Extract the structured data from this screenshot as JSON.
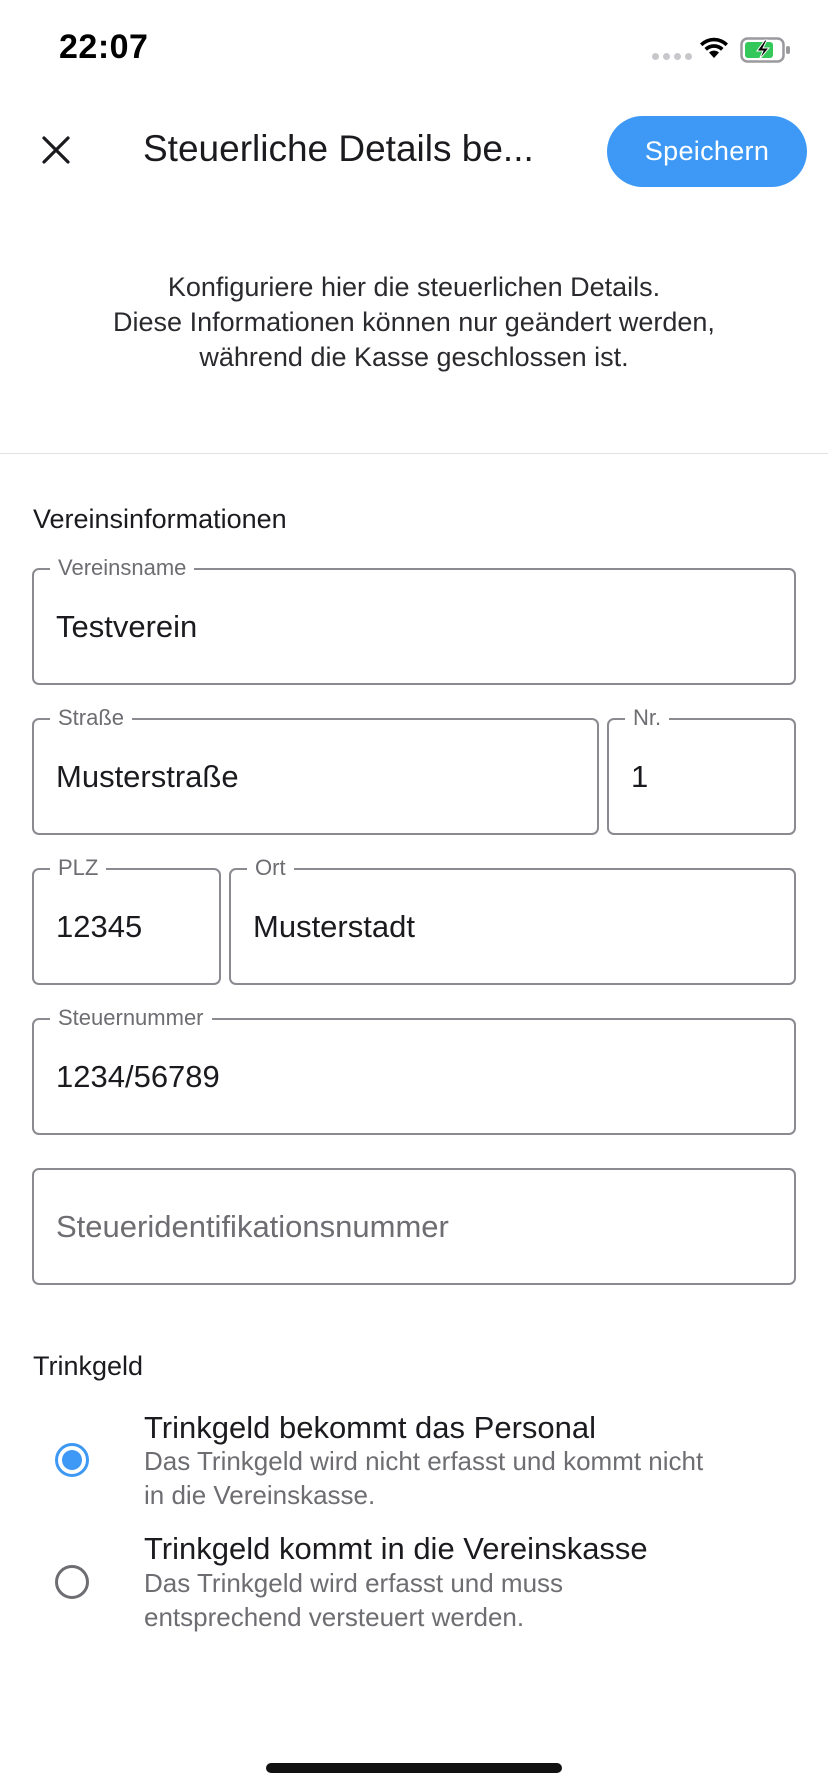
{
  "status_bar": {
    "time": "22:07"
  },
  "header": {
    "title": "Steuerliche Details be...",
    "save_label": "Speichern"
  },
  "intro": {
    "lines": [
      "Konfiguriere hier die steuerlichen Details.",
      "Diese Informationen können nur geändert werden,",
      "während die Kasse geschlossen ist."
    ]
  },
  "club_section": {
    "heading": "Vereinsinformationen",
    "fields": {
      "name": {
        "label": "Vereinsname",
        "value": "Testverein"
      },
      "street": {
        "label": "Straße",
        "value": "Musterstraße"
      },
      "number": {
        "label": "Nr.",
        "value": "1"
      },
      "zip": {
        "label": "PLZ",
        "value": "12345"
      },
      "city": {
        "label": "Ort",
        "value": "Musterstadt"
      },
      "tax_number": {
        "label": "Steuernummer",
        "value": "1234/56789"
      },
      "tax_id": {
        "placeholder": "Steueridentifikationsnummer"
      }
    }
  },
  "tip_section": {
    "heading": "Trinkgeld",
    "options": [
      {
        "title": "Trinkgeld bekommt das Personal",
        "desc_lines": [
          "Das Trinkgeld wird nicht erfasst und kommt nicht",
          "in die Vereinskasse."
        ],
        "selected": true
      },
      {
        "title": "Trinkgeld kommt in die Vereinskasse",
        "desc_lines": [
          "Das Trinkgeld wird erfasst und muss",
          "entsprechend versteuert werden."
        ],
        "selected": false
      }
    ]
  },
  "colors": {
    "accent": "#3d99f5",
    "border": "#8a8a90",
    "secondary_text": "#6d6d72"
  }
}
